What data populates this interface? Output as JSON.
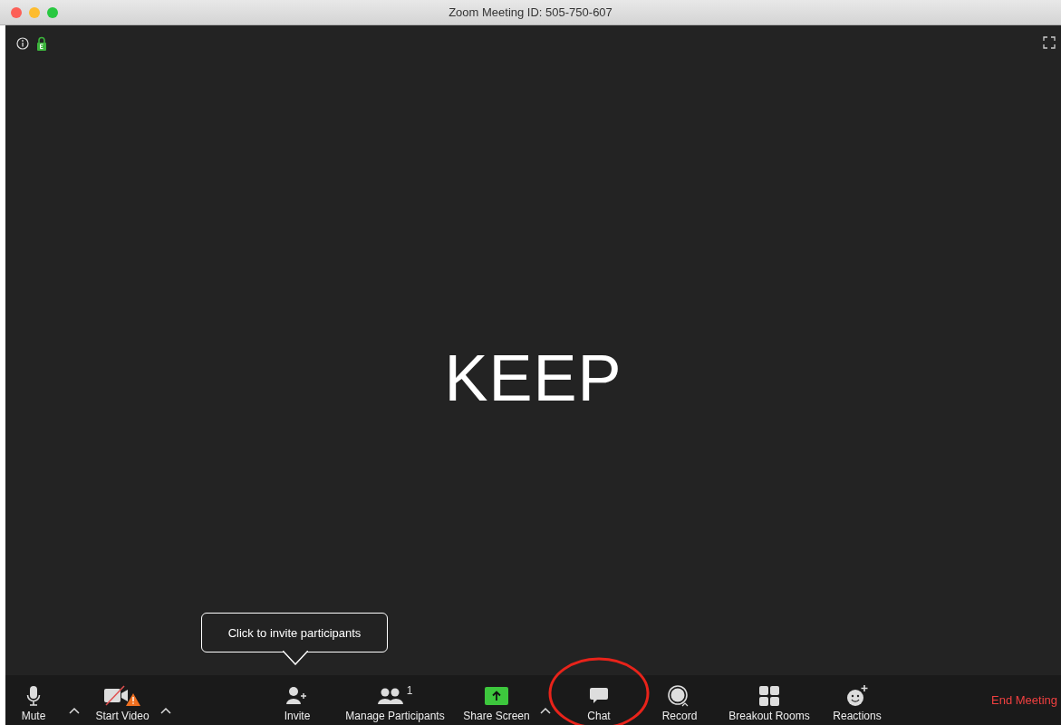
{
  "window": {
    "title": "Zoom Meeting ID: 505-750-607"
  },
  "meeting": {
    "encrypted": true,
    "shared_text": "KEEP"
  },
  "tooltip": {
    "text": "Click to invite participants"
  },
  "toolbar": [
    {
      "kind": "mute",
      "label": "Mute",
      "highlighted": false
    },
    {
      "kind": "caret"
    },
    {
      "kind": "video",
      "label": "Start Video",
      "warning": true,
      "highlighted": false
    },
    {
      "kind": "caret"
    },
    {
      "kind": "invite",
      "label": "Invite",
      "highlighted": false
    },
    {
      "kind": "participants",
      "label": "Manage Participants",
      "count": "1",
      "highlighted": false
    },
    {
      "kind": "share",
      "label": "Share Screen",
      "highlighted": false
    },
    {
      "kind": "caret"
    },
    {
      "kind": "chat",
      "label": "Chat",
      "highlighted": true
    },
    {
      "kind": "record",
      "label": "Record",
      "highlighted": false
    },
    {
      "kind": "breakout",
      "label": "Breakout Rooms",
      "highlighted": false
    },
    {
      "kind": "reactions",
      "label": "Reactions",
      "highlighted": false
    }
  ],
  "end_button": {
    "label": "End Meeting"
  }
}
